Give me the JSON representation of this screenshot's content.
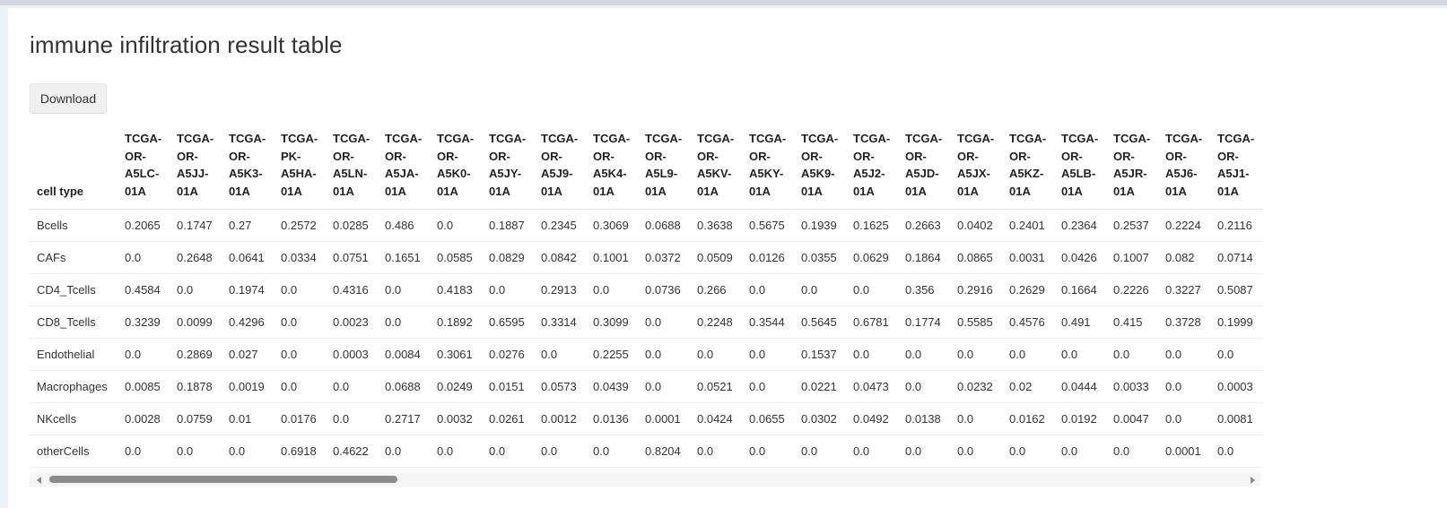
{
  "title": "immune infiltration result table",
  "download_label": "Download",
  "table": {
    "first_header": "cell type",
    "columns": [
      [
        "TCGA-",
        "OR-",
        "A5LC-",
        "01A"
      ],
      [
        "TCGA-",
        "OR-",
        "A5JJ-",
        "01A"
      ],
      [
        "TCGA-",
        "OR-",
        "A5K3-",
        "01A"
      ],
      [
        "TCGA-",
        "PK-",
        "A5HA-",
        "01A"
      ],
      [
        "TCGA-",
        "OR-",
        "A5LN-",
        "01A"
      ],
      [
        "TCGA-",
        "OR-",
        "A5JA-",
        "01A"
      ],
      [
        "TCGA-",
        "OR-",
        "A5K0-",
        "01A"
      ],
      [
        "TCGA-",
        "OR-",
        "A5JY-",
        "01A"
      ],
      [
        "TCGA-",
        "OR-",
        "A5J9-",
        "01A"
      ],
      [
        "TCGA-",
        "OR-",
        "A5K4-",
        "01A"
      ],
      [
        "TCGA-",
        "OR-",
        "A5L9-",
        "01A"
      ],
      [
        "TCGA-",
        "OR-",
        "A5KV-",
        "01A"
      ],
      [
        "TCGA-",
        "OR-",
        "A5KY-",
        "01A"
      ],
      [
        "TCGA-",
        "OR-",
        "A5K9-",
        "01A"
      ],
      [
        "TCGA-",
        "OR-",
        "A5J2-",
        "01A"
      ],
      [
        "TCGA-",
        "OR-",
        "A5JD-",
        "01A"
      ],
      [
        "TCGA-",
        "OR-",
        "A5JX-",
        "01A"
      ],
      [
        "TCGA-",
        "OR-",
        "A5KZ-",
        "01A"
      ],
      [
        "TCGA-",
        "OR-",
        "A5LB-",
        "01A"
      ],
      [
        "TCGA-",
        "OR-",
        "A5JR-",
        "01A"
      ],
      [
        "TCGA-",
        "OR-",
        "A5J6-",
        "01A"
      ],
      [
        "TCGA-",
        "OR-",
        "A5J1-",
        "01A"
      ]
    ],
    "rows": [
      {
        "cell_type": "Bcells",
        "values": [
          "0.2065",
          "0.1747",
          "0.27",
          "0.2572",
          "0.0285",
          "0.486",
          "0.0",
          "0.1887",
          "0.2345",
          "0.3069",
          "0.0688",
          "0.3638",
          "0.5675",
          "0.1939",
          "0.1625",
          "0.2663",
          "0.0402",
          "0.2401",
          "0.2364",
          "0.2537",
          "0.2224",
          "0.2116"
        ]
      },
      {
        "cell_type": "CAFs",
        "values": [
          "0.0",
          "0.2648",
          "0.0641",
          "0.0334",
          "0.0751",
          "0.1651",
          "0.0585",
          "0.0829",
          "0.0842",
          "0.1001",
          "0.0372",
          "0.0509",
          "0.0126",
          "0.0355",
          "0.0629",
          "0.1864",
          "0.0865",
          "0.0031",
          "0.0426",
          "0.1007",
          "0.082",
          "0.0714"
        ]
      },
      {
        "cell_type": "CD4_Tcells",
        "values": [
          "0.4584",
          "0.0",
          "0.1974",
          "0.0",
          "0.4316",
          "0.0",
          "0.4183",
          "0.0",
          "0.2913",
          "0.0",
          "0.0736",
          "0.266",
          "0.0",
          "0.0",
          "0.0",
          "0.356",
          "0.2916",
          "0.2629",
          "0.1664",
          "0.2226",
          "0.3227",
          "0.5087"
        ]
      },
      {
        "cell_type": "CD8_Tcells",
        "values": [
          "0.3239",
          "0.0099",
          "0.4296",
          "0.0",
          "0.0023",
          "0.0",
          "0.1892",
          "0.6595",
          "0.3314",
          "0.3099",
          "0.0",
          "0.2248",
          "0.3544",
          "0.5645",
          "0.6781",
          "0.1774",
          "0.5585",
          "0.4576",
          "0.491",
          "0.415",
          "0.3728",
          "0.1999"
        ]
      },
      {
        "cell_type": "Endothelial",
        "values": [
          "0.0",
          "0.2869",
          "0.027",
          "0.0",
          "0.0003",
          "0.0084",
          "0.3061",
          "0.0276",
          "0.0",
          "0.2255",
          "0.0",
          "0.0",
          "0.0",
          "0.1537",
          "0.0",
          "0.0",
          "0.0",
          "0.0",
          "0.0",
          "0.0",
          "0.0",
          "0.0"
        ]
      },
      {
        "cell_type": "Macrophages",
        "values": [
          "0.0085",
          "0.1878",
          "0.0019",
          "0.0",
          "0.0",
          "0.0688",
          "0.0249",
          "0.0151",
          "0.0573",
          "0.0439",
          "0.0",
          "0.0521",
          "0.0",
          "0.0221",
          "0.0473",
          "0.0",
          "0.0232",
          "0.02",
          "0.0444",
          "0.0033",
          "0.0",
          "0.0003"
        ]
      },
      {
        "cell_type": "NKcells",
        "values": [
          "0.0028",
          "0.0759",
          "0.01",
          "0.0176",
          "0.0",
          "0.2717",
          "0.0032",
          "0.0261",
          "0.0012",
          "0.0136",
          "0.0001",
          "0.0424",
          "0.0655",
          "0.0302",
          "0.0492",
          "0.0138",
          "0.0",
          "0.0162",
          "0.0192",
          "0.0047",
          "0.0",
          "0.0081"
        ]
      },
      {
        "cell_type": "otherCells",
        "values": [
          "0.0",
          "0.0",
          "0.0",
          "0.6918",
          "0.4622",
          "0.0",
          "0.0",
          "0.0",
          "0.0",
          "0.0",
          "0.8204",
          "0.0",
          "0.0",
          "0.0",
          "0.0",
          "0.0",
          "0.0",
          "0.0",
          "0.0",
          "0.0",
          "0.0001",
          "0.0"
        ]
      }
    ]
  }
}
